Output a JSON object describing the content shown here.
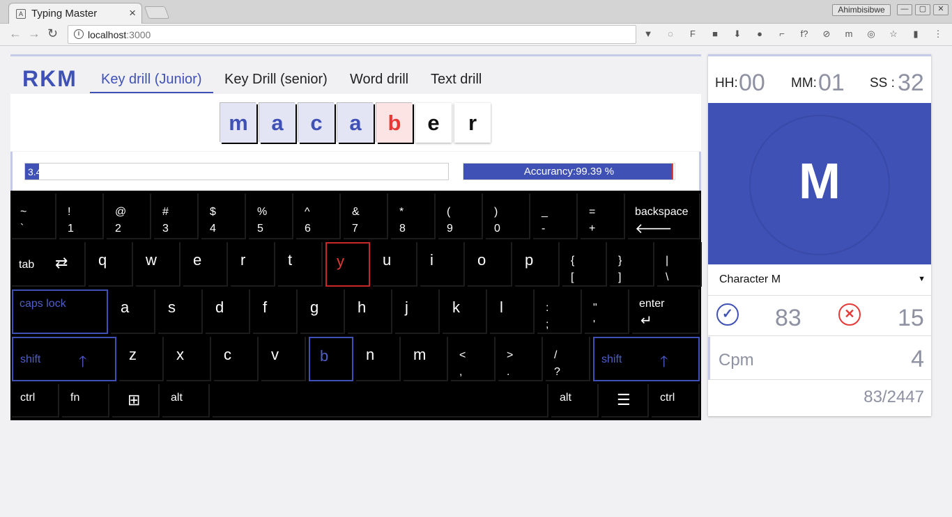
{
  "browser": {
    "tab_title": "Typing Master",
    "tab_close": "×",
    "favicon_letter": "A",
    "user_name": "Ahimbisibwe",
    "url_host": "localhost",
    "url_port": ":3000",
    "win_min": "—",
    "win_max": "▢",
    "win_close": "✕",
    "back_glyph": "←",
    "forward_glyph": "→",
    "reload_glyph": "↻",
    "info_glyph": "i",
    "ext_icons": [
      "▼",
      "◌",
      "F",
      "■",
      "⬇",
      "●",
      "⌐",
      "f?",
      "⊘",
      "m",
      "◎",
      "☆",
      "▮",
      "⋮"
    ]
  },
  "app": {
    "brand": "RKM",
    "tabs": [
      "Key drill (Junior)",
      "Key Drill (senior)",
      "Word drill",
      "Text drill"
    ],
    "active_tab": 0
  },
  "word": {
    "chars": [
      {
        "ch": "m",
        "state": "done"
      },
      {
        "ch": "a",
        "state": "done"
      },
      {
        "ch": "c",
        "state": "done"
      },
      {
        "ch": "a",
        "state": "done"
      },
      {
        "ch": "b",
        "state": "error"
      },
      {
        "ch": "e",
        "state": "pending"
      },
      {
        "ch": "r",
        "state": "pending"
      }
    ]
  },
  "progress": {
    "label": "3.4",
    "value_percent": 3.4
  },
  "accuracy": {
    "label": "Accurancy:99.39 %",
    "value_percent": 99.39
  },
  "keyboard": {
    "row1": [
      {
        "t": "~",
        "b": "`"
      },
      {
        "t": "!",
        "b": "1"
      },
      {
        "t": "@",
        "b": "2"
      },
      {
        "t": "#",
        "b": "3"
      },
      {
        "t": "$",
        "b": "4"
      },
      {
        "t": "%",
        "b": "5"
      },
      {
        "t": "^",
        "b": "6"
      },
      {
        "t": "&",
        "b": "7"
      },
      {
        "t": "*",
        "b": "8"
      },
      {
        "t": "(",
        "b": "9"
      },
      {
        "t": ")",
        "b": "0"
      },
      {
        "t": "_",
        "b": "-"
      },
      {
        "t": "=",
        "b": "+"
      }
    ],
    "backspace_label": "backspace",
    "backspace_glyph": "🡐",
    "tab_label": "tab",
    "tab_glyph": "⇄",
    "row2": [
      "q",
      "w",
      "e",
      "r",
      "t",
      "y",
      "u",
      "i",
      "o",
      "p"
    ],
    "row2_sym": [
      {
        "t": "{",
        "b": "["
      },
      {
        "t": "}",
        "b": "]"
      },
      {
        "t": "|",
        "b": "\\"
      }
    ],
    "caps_label": "caps lock",
    "row3": [
      "a",
      "s",
      "d",
      "f",
      "g",
      "h",
      "j",
      "k",
      "l"
    ],
    "row3_sym": [
      {
        "t": ":",
        "b": ";"
      },
      {
        "t": "\"",
        "b": "'"
      }
    ],
    "enter_label": "enter",
    "enter_glyph": "↵",
    "shift_label": "shift",
    "shift_glyph": "🡑",
    "row4": [
      "z",
      "x",
      "c",
      "v",
      "b",
      "n",
      "m"
    ],
    "row4_sym": [
      {
        "t": "<",
        "b": ","
      },
      {
        "t": ">",
        "b": "."
      },
      {
        "t": "/",
        "b": "?"
      }
    ],
    "ctrl_label": "ctrl",
    "fn_label": "fn",
    "alt_label": "alt",
    "win_glyph": "⊞",
    "menu_glyph": "☰",
    "next_key": "y",
    "highlight_keys": [
      "b",
      "caps",
      "shift"
    ]
  },
  "timer": {
    "hh_label": "HH:",
    "hh": "00",
    "mm_label": "MM:",
    "mm": "01",
    "ss_label": "SS :",
    "ss": "32"
  },
  "current_char": "M",
  "char_select": "Character M",
  "char_select_caret": "▼",
  "stats": {
    "correct_glyph": "✓",
    "correct": "83",
    "error_glyph": "✕",
    "errors": "15",
    "cpm_label": "Cpm",
    "cpm": "4",
    "count": "83/2447"
  },
  "colors": {
    "accent": "#3f51b5",
    "error": "#e53935",
    "muted": "#8e91a1"
  }
}
